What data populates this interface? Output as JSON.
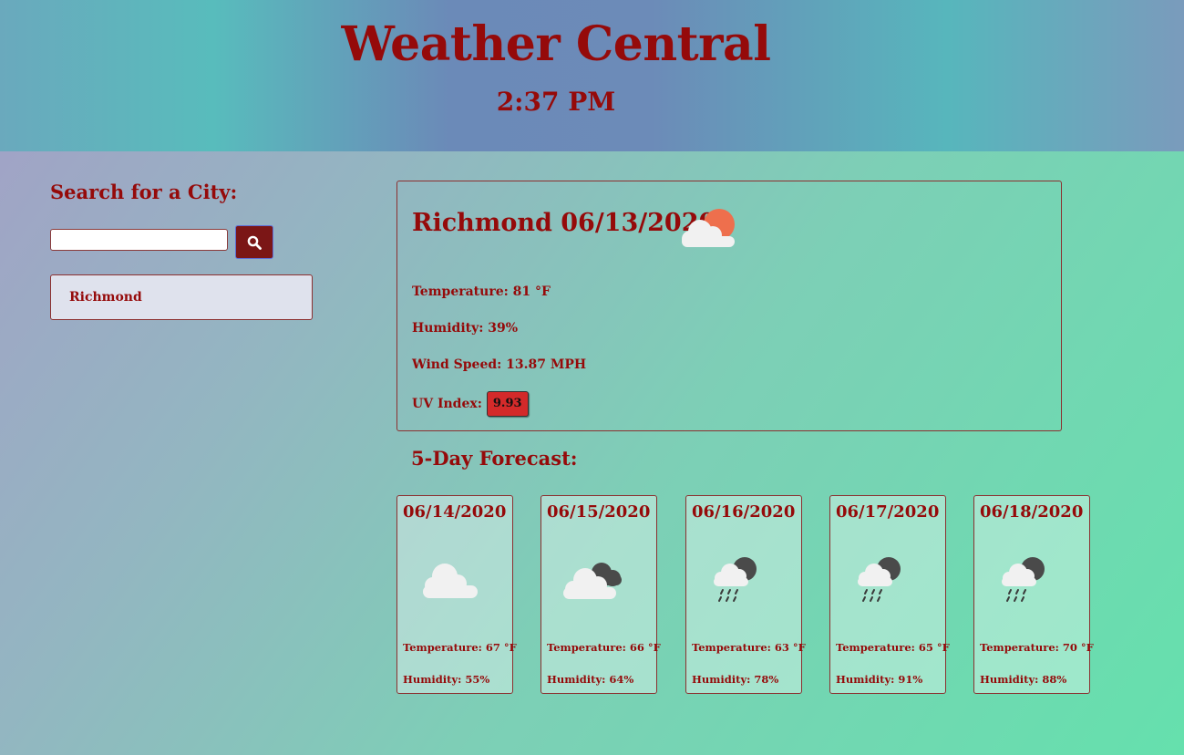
{
  "header": {
    "title": "Weather Central",
    "time": "2:37 PM"
  },
  "search": {
    "heading": "Search for a City:",
    "input_value": "",
    "placeholder": "",
    "button_icon": "search-icon",
    "history": [
      "Richmond"
    ]
  },
  "current": {
    "city_date": "Richmond 06/13/2020",
    "icon": "partly-cloudy-day-icon",
    "temperature": "Temperature: 81 °F",
    "humidity": "Humidity: 39%",
    "wind": "Wind Speed: 13.87 MPH",
    "uv_label": "UV Index:",
    "uv_value": "9.93",
    "uv_color": "#d32a2a"
  },
  "forecast": {
    "heading": "5-Day Forecast:",
    "days": [
      {
        "date": "06/14/2020",
        "icon": "cloud-icon",
        "temp": "Temperature: 67 °F",
        "humidity": "Humidity: 55%"
      },
      {
        "date": "06/15/2020",
        "icon": "partly-cloudy-night-icon",
        "temp": "Temperature: 66 °F",
        "humidity": "Humidity: 64%"
      },
      {
        "date": "06/16/2020",
        "icon": "rain-night-icon",
        "temp": "Temperature: 63 °F",
        "humidity": "Humidity: 78%"
      },
      {
        "date": "06/17/2020",
        "icon": "rain-night-icon",
        "temp": "Temperature: 65 °F",
        "humidity": "Humidity: 91%"
      },
      {
        "date": "06/18/2020",
        "icon": "rain-night-icon",
        "temp": "Temperature: 70 °F",
        "humidity": "Humidity: 88%"
      }
    ]
  },
  "colors": {
    "accent": "#950a0a",
    "button": "#7b1616"
  }
}
